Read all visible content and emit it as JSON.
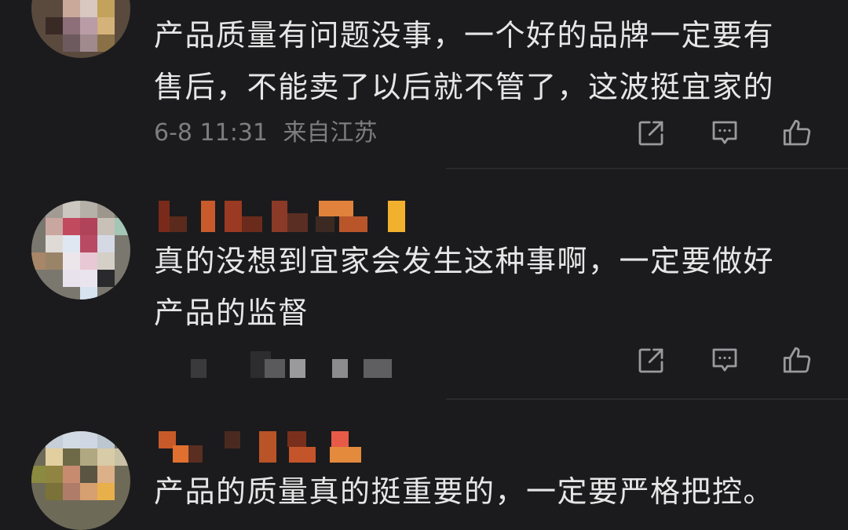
{
  "comments": [
    {
      "text_lines": [
        "产品质量有问题没事，一个好的品牌一定要有",
        "售后，不能卖了以后就不管了，这波挺宜家的"
      ],
      "time": "6-8 11:31",
      "location": "来自江苏"
    },
    {
      "text_lines": [
        "真的没想到宜家会发生这种事啊，一定要做好",
        "产品的监督"
      ]
    },
    {
      "text_lines": [
        "产品的质量真的挺重要的，一定要严格把控。"
      ]
    }
  ],
  "icons": {
    "share": "share-icon",
    "reply": "comment-icon",
    "like": "thumbs-up-icon"
  },
  "colors": {
    "background": "#1b1b1d",
    "text": "#e6e6e6",
    "meta": "#7d7d80",
    "icon": "#9a9a9d"
  }
}
